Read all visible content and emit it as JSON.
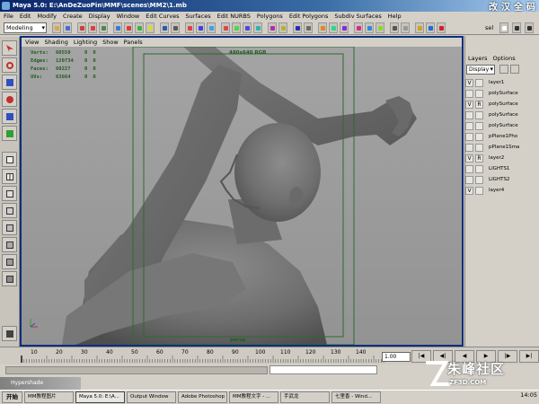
{
  "title_bar": {
    "title": "Maya 5.0: E:\\AnDeZuoPin\\MMF\\scenes\\MM2\\1.mb"
  },
  "window_controls_text": [
    "改",
    "汉",
    "全",
    "码"
  ],
  "menu": [
    "File",
    "Edit",
    "Modify",
    "Create",
    "Display",
    "Window",
    "Edit Curves",
    "Surfaces",
    "Edit NURBS",
    "Polygons",
    "Edit Polygons",
    "Subdiv Surfaces",
    "Help"
  ],
  "shelf": {
    "mode": "Modeling",
    "sel_label": "sel"
  },
  "panel_menu": [
    "View",
    "Shading",
    "Lighting",
    "Show",
    "Panels"
  ],
  "hud": {
    "rows": [
      {
        "label": "Verts:",
        "v1": "60550",
        "v2": "0",
        "v3": "0"
      },
      {
        "label": "Edges:",
        "v1": "120734",
        "v2": "0",
        "v3": "0"
      },
      {
        "label": "Faces:",
        "v1": "60227",
        "v2": "0",
        "v3": "0"
      },
      {
        "label": "UVs:",
        "v1": "63664",
        "v2": "0",
        "v3": "0"
      }
    ]
  },
  "camera_name": "480x640 RGB",
  "frame_label": "persp",
  "right_panel": {
    "tabs": [
      "Layers",
      "Options"
    ],
    "display": "Display",
    "layers": [
      {
        "v": "V",
        "r": "",
        "name": "layer1"
      },
      {
        "v": "",
        "r": "",
        "name": "polySurface"
      },
      {
        "v": "V",
        "r": "R",
        "name": "polySurface"
      },
      {
        "v": "",
        "r": "",
        "name": "polySurface"
      },
      {
        "v": "",
        "r": "",
        "name": "polySurface"
      },
      {
        "v": "",
        "r": "",
        "name": "pPlane1Pho"
      },
      {
        "v": "",
        "r": "",
        "name": "pPlane1Sma"
      },
      {
        "v": "V",
        "r": "R",
        "name": "layer2"
      },
      {
        "v": "",
        "r": "",
        "name": "LIGHTS1"
      },
      {
        "v": "",
        "r": "",
        "name": "LIGHTS2"
      },
      {
        "v": "V",
        "r": "",
        "name": "layer4"
      }
    ]
  },
  "time_slider": {
    "ticks": [
      "10",
      "20",
      "30",
      "40",
      "50",
      "60",
      "70",
      "80",
      "90",
      "100",
      "110",
      "120",
      "130",
      "140"
    ],
    "current_frame": "1.00"
  },
  "playback": [
    "|◀",
    "◀|",
    "◀",
    "▶",
    "|▶",
    "▶|"
  ],
  "hypershade": "Hypershade",
  "taskbar": {
    "start": "开始",
    "items": [
      "MM教程图片",
      "Maya 5.0: E:\\A...",
      "Output Window",
      "Adobe Photoshop",
      "MM教程文字 - ...",
      "手武龙",
      "七里香 - Wind..."
    ],
    "clock": "14:05"
  },
  "watermark": {
    "text": "朱峰社区",
    "url": "ZF3D.COM"
  },
  "colors": {
    "title_bar": "#0a246a",
    "viewport_bg": "#9a9a9a",
    "viewport_frame": "#0c2f7a",
    "gate_lines": "#2d6b2d",
    "ui_gray": "#d4d0c8"
  }
}
